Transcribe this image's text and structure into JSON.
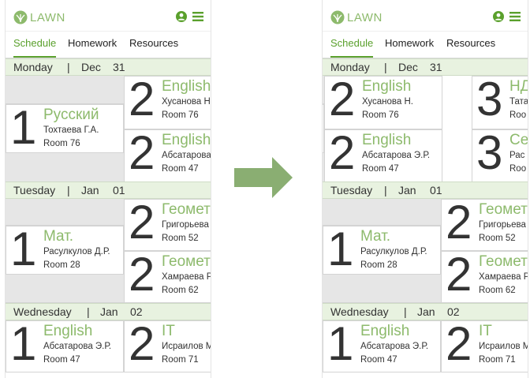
{
  "app": {
    "logo_text": "LAWN",
    "accent_color": "#5aa02c",
    "logo_color": "#8dba6c"
  },
  "tabs": [
    {
      "label": "Schedule",
      "active": true
    },
    {
      "label": "Homework",
      "active": false
    },
    {
      "label": "Resources",
      "active": false
    }
  ],
  "days": [
    {
      "day": "Monday",
      "month": "Dec",
      "date": "31"
    },
    {
      "day": "Tuesday",
      "month": "Jan",
      "date": "01"
    },
    {
      "day": "Wednesday",
      "month": "Jan",
      "date": "02"
    }
  ],
  "lessons": {
    "monday": [
      {
        "number": "1",
        "subject": "Русский",
        "teacher": "Тохтаева Г.А.",
        "room": "Room 76"
      },
      {
        "number": "2",
        "subject": "English",
        "teacher": "Хусанова Н.",
        "room": "Room 76"
      },
      {
        "number": "2",
        "subject": "English",
        "teacher": "Абсатарова Э.Р.",
        "room": "Room 47"
      },
      {
        "number": "3",
        "subject": "НД",
        "teacher": "Тата",
        "room": "Roo"
      },
      {
        "number": "3",
        "subject": "Се",
        "teacher": "Рас",
        "room": "Roo"
      }
    ],
    "tuesday": [
      {
        "number": "1",
        "subject": "Мат.",
        "teacher": "Расулкулов Д.Р.",
        "room": "Room 28"
      },
      {
        "number": "2",
        "subject": "Геометрия",
        "teacher": "Григорьева",
        "room": "Room 52"
      },
      {
        "number": "2",
        "subject": "Геометрия",
        "teacher": "Хамраева Р.",
        "room": "Room 62"
      }
    ],
    "wednesday": [
      {
        "number": "1",
        "subject": "English",
        "teacher": "Абсатарова Э.Р.",
        "room": "Room 47"
      },
      {
        "number": "2",
        "subject": "IT",
        "teacher": "Исраилов М.",
        "room": "Room 71"
      }
    ]
  }
}
